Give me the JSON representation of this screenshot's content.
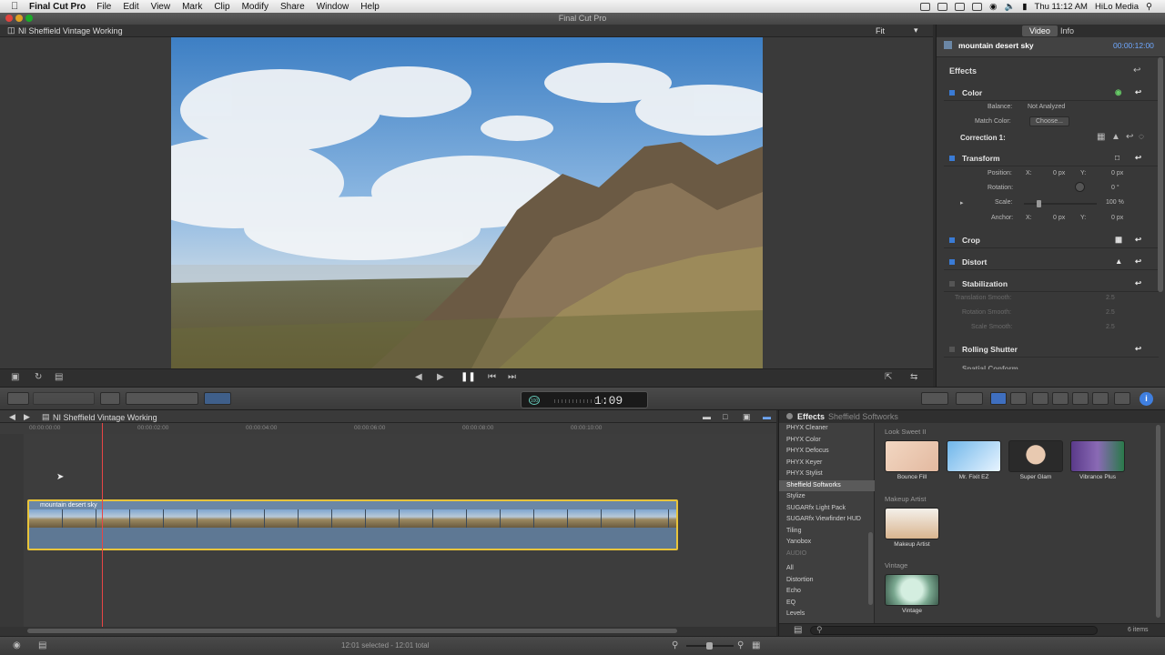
{
  "menubar": {
    "app_name": "Final Cut Pro",
    "items": [
      "File",
      "Edit",
      "View",
      "Mark",
      "Clip",
      "Modify",
      "Share",
      "Window",
      "Help"
    ],
    "clock": "Thu 11:12 AM",
    "user": "HiLo Media"
  },
  "window": {
    "title": "Final Cut Pro"
  },
  "viewer": {
    "project_title": "NI Sheffield Vintage Working",
    "zoom": "Fit"
  },
  "inspector": {
    "tabs": [
      "Video",
      "Info"
    ],
    "clip_name": "mountain desert sky",
    "duration": "00:00:12:00",
    "effects_label": "Effects",
    "color": {
      "label": "Color",
      "balance_label": "Balance:",
      "balance_value": "Not Analyzed",
      "match_label": "Match Color:",
      "match_button": "Choose..."
    },
    "correction_label": "Correction 1:",
    "transform": {
      "label": "Transform",
      "position_label": "Position:",
      "x": "X:",
      "y": "Y:",
      "pos_x": "0 px",
      "pos_y": "0 px",
      "rotation_label": "Rotation:",
      "rotation_value": "0 °",
      "scale_label": "Scale:",
      "scale_value": "100 %",
      "anchor_label": "Anchor:",
      "anchor_x": "0 px",
      "anchor_y": "0 px"
    },
    "crop_label": "Crop",
    "distort_label": "Distort",
    "stabilization": {
      "label": "Stabilization",
      "translation": "Translation Smooth:",
      "rotation": "Rotation Smooth:",
      "scale": "Scale Smooth:",
      "value": "2.5"
    },
    "rolling_label": "Rolling Shutter",
    "spatial_label": "Spatial Conform"
  },
  "toolbar": {
    "timecode": "1:09",
    "timecode_prefix": "100"
  },
  "timeline": {
    "project_title": "NI Sheffield Vintage Working",
    "ruler": [
      "00:00:00:00",
      "00:00:02:00",
      "00:00:04:00",
      "00:00:06:00",
      "00:00:08:00",
      "00:00:10:00"
    ],
    "clip_name": "mountain desert sky",
    "status": "12:01 selected - 12:01 total"
  },
  "browser": {
    "title": "Effects",
    "breadcrumb": "Sheffield Softworks",
    "categories": [
      "PHYX Cleaner",
      "PHYX Color",
      "PHYX Defocus",
      "PHYX Keyer",
      "PHYX Stylist",
      "Sheffield Softworks",
      "Stylize",
      "SUGARfx Light Pack",
      "SUGARfx Viewfinder HUD",
      "Tiling",
      "Yanobox",
      "AUDIO",
      "All",
      "Distortion",
      "Echo",
      "EQ",
      "Levels"
    ],
    "selected_category": "Sheffield Softworks",
    "groups": [
      {
        "name": "Look Sweet II",
        "items": [
          "Bounce Fill",
          "Mr. Fixit EZ",
          "Super Glam",
          "Vibrance Plus"
        ]
      },
      {
        "name": "Makeup Artist",
        "items": [
          "Makeup Artist"
        ]
      },
      {
        "name": "Vintage",
        "items": [
          "Vintage"
        ]
      }
    ],
    "count": "6 items"
  },
  "colors": {
    "accent": "#3a7bd5",
    "selection": "#e8c43a",
    "playhead": "#e94545"
  }
}
